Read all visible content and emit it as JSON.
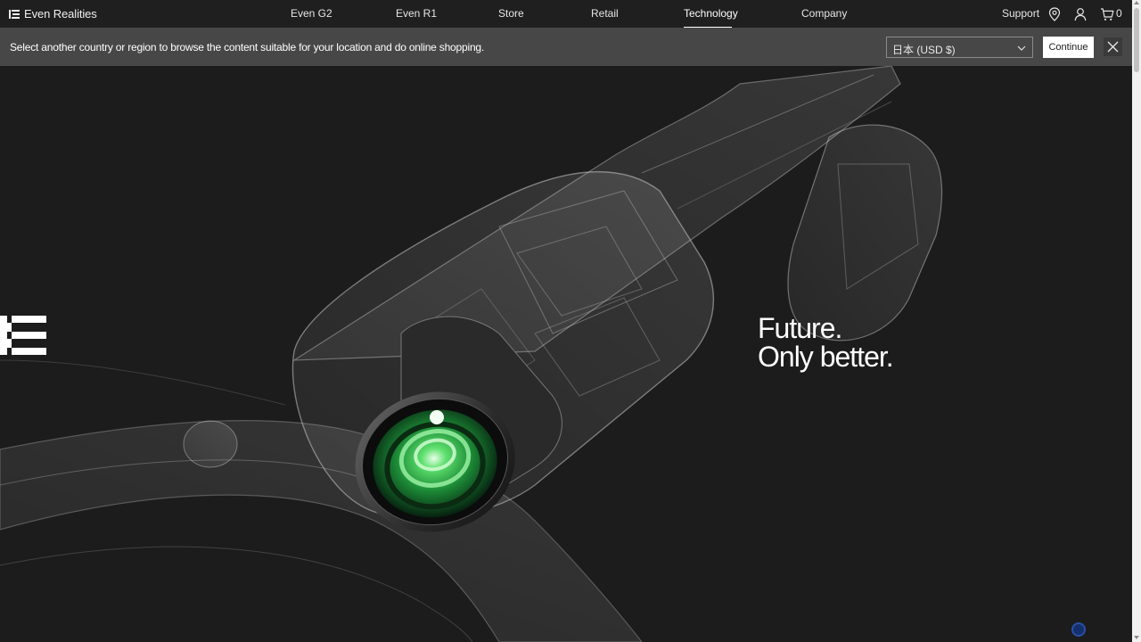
{
  "header": {
    "brand": "Even Realities",
    "nav": [
      {
        "label": "Even G2"
      },
      {
        "label": "Even R1"
      },
      {
        "label": "Store"
      },
      {
        "label": "Retail"
      },
      {
        "label": "Technology",
        "active": true
      },
      {
        "label": "Company"
      }
    ],
    "support": "Support",
    "cart_count": "0",
    "icons": [
      "brand-logo-icon",
      "location-pin-icon",
      "user-icon",
      "cart-icon"
    ]
  },
  "region_banner": {
    "message": "Select another country or region to browse the content suitable for your location and do online shopping.",
    "selected_region": "日本 (USD $)",
    "continue_label": "Continue",
    "icons": [
      "chevron-down-icon",
      "close-icon"
    ]
  },
  "hero": {
    "headline_line1": "Future.",
    "headline_line2": "Only better.",
    "image": "smart-glasses-xray-render",
    "accent_color": "#3ecf5a"
  },
  "colors": {
    "nav_bg": "#1f1f1f",
    "banner_bg": "#474747",
    "hero_bg": "#1c1c1c"
  }
}
